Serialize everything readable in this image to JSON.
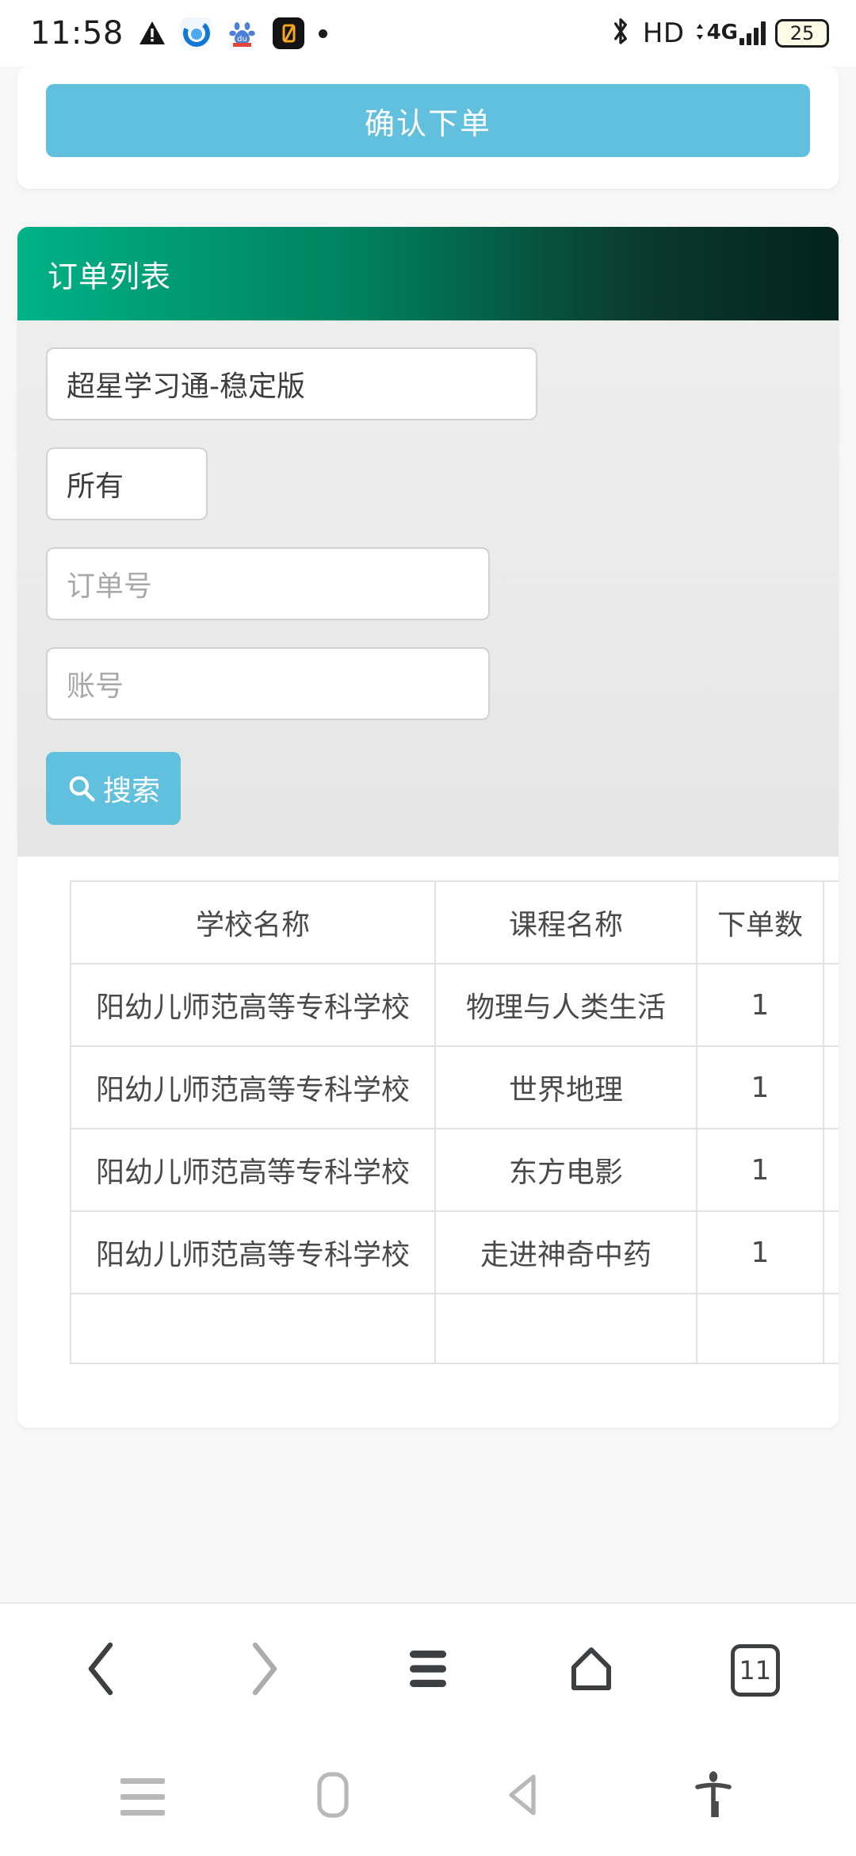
{
  "status_bar": {
    "time": "11:58",
    "icons_left": [
      "warning-triangle-icon",
      "qq-browser-icon",
      "baidu-icon",
      "app-dark-icon",
      "dot-icon"
    ],
    "bluetooth": "bluetooth-icon",
    "hd_label": "HD",
    "network_label": "4G",
    "signal": "signal-bars-icon",
    "battery_level": "25"
  },
  "top_card": {
    "submit_label": "确认下单"
  },
  "order_panel": {
    "title": "订单列表",
    "platform_select": {
      "value": "超星学习通-稳定版",
      "name": "platform-select"
    },
    "scope_select": {
      "value": "所有",
      "name": "scope-select"
    },
    "order_no_input": {
      "value": "",
      "placeholder": "订单号"
    },
    "account_input": {
      "value": "",
      "placeholder": "账号"
    },
    "search_button": {
      "label": "搜索",
      "icon": "search-icon"
    }
  },
  "table": {
    "headers": [
      "学校名称",
      "课程名称",
      "下单数",
      ""
    ],
    "rows": [
      {
        "school": "阳幼儿师范高等专科学校",
        "course": "物理与人类生活",
        "count": "1",
        "extra": ""
      },
      {
        "school": "阳幼儿师范高等专科学校",
        "course": "世界地理",
        "count": "1",
        "extra": ""
      },
      {
        "school": "阳幼儿师范高等专科学校",
        "course": "东方电影",
        "count": "1",
        "extra": ""
      },
      {
        "school": "阳幼儿师范高等专科学校",
        "course": "走进神奇中药",
        "count": "1",
        "extra": ""
      }
    ],
    "footer_row": {
      "school": "",
      "course": "",
      "count": "",
      "extra": ""
    }
  },
  "browser_bar": {
    "back": "back-chevron-icon",
    "forward": "forward-chevron-icon",
    "menu": "menu-icon",
    "home": "home-icon",
    "tabs_count": "11"
  },
  "system_nav": {
    "recents": "recents-icon",
    "home": "home-pill-icon",
    "back": "back-triangle-icon",
    "accessibility": "accessibility-icon"
  },
  "colors": {
    "accent_blue": "#62c0df",
    "panel_green_start": "#00b286",
    "panel_green_end": "#04231c",
    "page_bg": "#f7f7f7"
  }
}
